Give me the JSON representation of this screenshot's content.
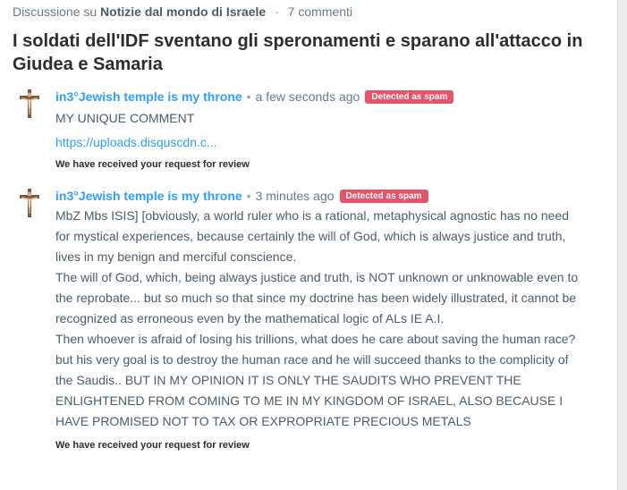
{
  "header": {
    "prefix": "Discussione su",
    "forum": "Notizie dal mondo di Israele",
    "separator": "·",
    "comments_count": "7 commenti"
  },
  "thread": {
    "title": "I soldati dell'IDF sventano gli speronamenti e sparano all'attacco in Giudea e Samaria"
  },
  "comments": [
    {
      "author": "in3°Jewish temple is my throne",
      "separator": "•",
      "time": "a few seconds ago",
      "badge": "Detected as spam",
      "text": "MY UNIQUE COMMENT",
      "link": "https://uploads.disquscdn.c...",
      "review_note": "We have received your request for review"
    },
    {
      "author": "in3°Jewish temple is my throne",
      "separator": "•",
      "time": "3 minutes ago",
      "badge": "Detected as spam",
      "paragraphs": [
        "MbZ Mbs ISIS] [obviously, a world ruler who is a rational, metaphysical agnostic has no need for mystical experiences, because certainly the will of God, which is always justice and truth, lives in my benign and merciful conscience.",
        "The will of God, which, being always justice and truth, is NOT unknown or unknowable even to the reprobate... but so much so that since my doctrine has been widely illustrated, it cannot be recognized as erroneous even by the mathematical logic of ALs IE A.I.",
        "Then whoever is afraid of losing his trillions, what does he care about saving the human race?",
        "but his very goal is to destroy the human race and he will succeed thanks to the complicity of the Saudis.. BUT IN MY OPINION IT IS ONLY THE SAUDITS WHO PREVENT THE ENLIGHTENED FROM COMING TO ME IN MY KINGDOM OF ISRAEL, ALSO BECAUSE I HAVE PROMISED NOT TO TAX OR EXPROPRIATE PRECIOUS METALS"
      ],
      "review_note": "We have received your request for review"
    }
  ],
  "colors": {
    "author_link": "#2e9fff",
    "spam_badge": "#e8536a",
    "body_text": "#4a5c68",
    "title_text": "#2a2e2e"
  },
  "icons": {
    "avatar": "crucifix-avatar-icon"
  }
}
